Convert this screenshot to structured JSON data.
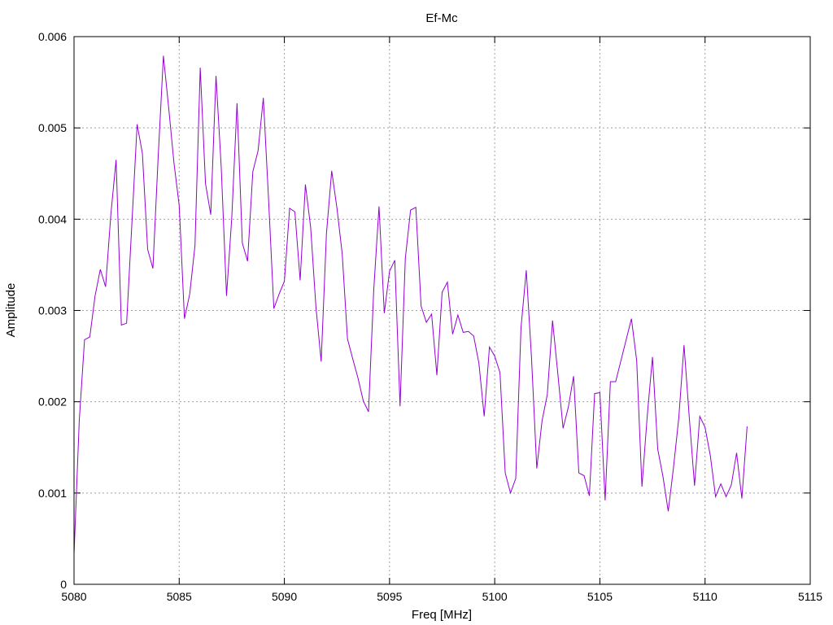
{
  "chart_data": {
    "type": "line",
    "title": "Ef-Mc",
    "xlabel": "Freq [MHz]",
    "ylabel": "Amplitude",
    "xlim": [
      5080,
      5115
    ],
    "ylim": [
      0,
      0.006
    ],
    "xticks": [
      5080,
      5085,
      5090,
      5095,
      5100,
      5105,
      5110,
      5115
    ],
    "xtick_labels": [
      "5080",
      "5085",
      "5090",
      "5095",
      "5100",
      "5105",
      "5110",
      "5115"
    ],
    "yticks": [
      0,
      0.001,
      0.002,
      0.003,
      0.004,
      0.005,
      0.006
    ],
    "ytick_labels": [
      "0",
      "0.001",
      "0.002",
      "0.003",
      "0.004",
      "0.005",
      "0.006"
    ],
    "grid": true,
    "line_color": "#9400d3",
    "series": [
      {
        "x": [
          5080.0,
          5080.25,
          5080.5,
          5080.75,
          5081.0,
          5081.25,
          5081.5,
          5081.75,
          5082.0,
          5082.25,
          5082.5,
          5082.75,
          5083.0,
          5083.25,
          5083.5,
          5083.75,
          5084.0,
          5084.25,
          5084.5,
          5084.75,
          5085.0,
          5085.25,
          5085.5,
          5085.75,
          5086.0,
          5086.25,
          5086.5,
          5086.75,
          5087.0,
          5087.25,
          5087.5,
          5087.75,
          5088.0,
          5088.25,
          5088.5,
          5088.75,
          5089.0,
          5089.25,
          5089.5,
          5089.75,
          5090.0,
          5090.25,
          5090.5,
          5090.75,
          5091.0,
          5091.25,
          5091.5,
          5091.75,
          5092.0,
          5092.25,
          5092.5,
          5092.75,
          5093.0,
          5093.25,
          5093.5,
          5093.75,
          5094.0,
          5094.25,
          5094.5,
          5094.75,
          5095.0,
          5095.25,
          5095.5,
          5095.75,
          5096.0,
          5096.25,
          5096.5,
          5096.75,
          5097.0,
          5097.25,
          5097.5,
          5097.75,
          5098.0,
          5098.25,
          5098.5,
          5098.75,
          5099.0,
          5099.25,
          5099.5,
          5099.75,
          5100.0,
          5100.25,
          5100.5,
          5100.75,
          5101.0,
          5101.25,
          5101.5,
          5101.75,
          5102.0,
          5102.25,
          5102.5,
          5102.75,
          5103.0,
          5103.25,
          5103.5,
          5103.75,
          5104.0,
          5104.25,
          5104.5,
          5104.75,
          5105.0,
          5105.25,
          5105.5,
          5105.75,
          5106.0,
          5106.25,
          5106.5,
          5106.75,
          5107.0,
          5107.25,
          5107.5,
          5107.75,
          5108.0,
          5108.25,
          5108.5,
          5108.75,
          5109.0,
          5109.25,
          5109.5,
          5109.75,
          5110.0,
          5110.25,
          5110.5,
          5110.75,
          5111.0,
          5111.25,
          5111.5,
          5111.75,
          5112.0
        ],
        "values": [
          0.00033,
          0.0018,
          0.00268,
          0.00271,
          0.00316,
          0.00345,
          0.00326,
          0.00405,
          0.00465,
          0.00284,
          0.00286,
          0.00395,
          0.00504,
          0.00472,
          0.00367,
          0.00346,
          0.00468,
          0.00579,
          0.00522,
          0.00462,
          0.00415,
          0.00291,
          0.00318,
          0.00371,
          0.00566,
          0.00439,
          0.00405,
          0.00557,
          0.00456,
          0.00316,
          0.00402,
          0.00527,
          0.00374,
          0.00354,
          0.00452,
          0.00475,
          0.00533,
          0.00421,
          0.00302,
          0.00318,
          0.00332,
          0.00412,
          0.00408,
          0.00333,
          0.00438,
          0.00391,
          0.00304,
          0.00244,
          0.00384,
          0.00453,
          0.00412,
          0.00362,
          0.00269,
          0.00247,
          0.00226,
          0.00201,
          0.00189,
          0.00323,
          0.00414,
          0.00297,
          0.00343,
          0.00355,
          0.00195,
          0.00357,
          0.0041,
          0.00413,
          0.00305,
          0.00287,
          0.00296,
          0.00229,
          0.0032,
          0.00331,
          0.00274,
          0.00295,
          0.00276,
          0.00277,
          0.00272,
          0.00242,
          0.00184,
          0.0026,
          0.0025,
          0.00232,
          0.00122,
          0.001,
          0.00116,
          0.00281,
          0.00344,
          0.00248,
          0.00127,
          0.00179,
          0.00208,
          0.00289,
          0.00231,
          0.00171,
          0.00194,
          0.00228,
          0.00122,
          0.00119,
          0.00097,
          0.00209,
          0.0021,
          0.00092,
          0.00222,
          0.00222,
          0.00245,
          0.00268,
          0.00291,
          0.00245,
          0.00107,
          0.00184,
          0.00249,
          0.00148,
          0.00118,
          0.0008,
          0.00128,
          0.00182,
          0.00262,
          0.00183,
          0.00108,
          0.00184,
          0.00172,
          0.00141,
          0.00096,
          0.0011,
          0.00096,
          0.00109,
          0.00144,
          0.00094,
          0.00173
        ]
      }
    ]
  }
}
